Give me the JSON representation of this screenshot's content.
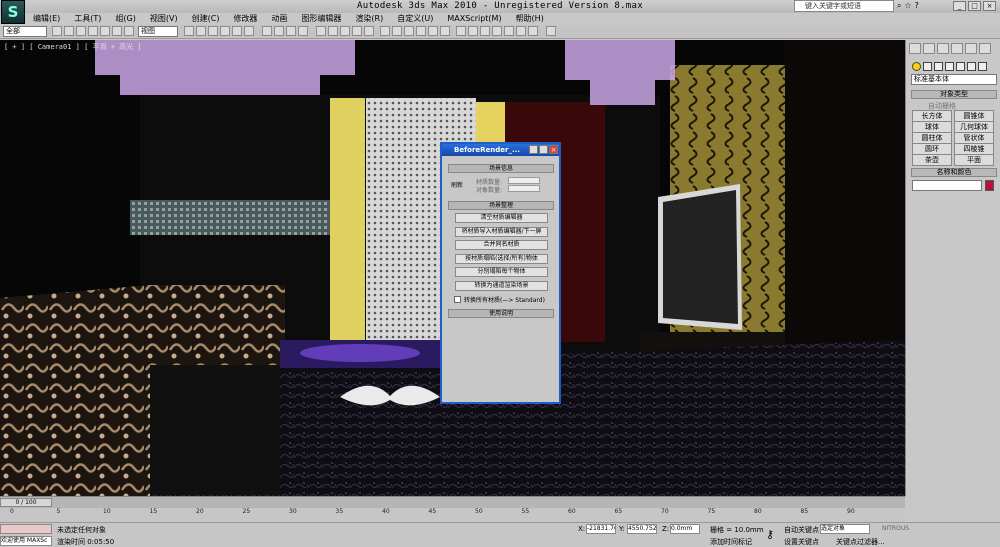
{
  "app": {
    "title": "Autodesk 3ds Max  2010  - Unregistered Version  8.max",
    "logo_text": "S"
  },
  "help_search": {
    "placeholder": "键入关键字或短语"
  },
  "menu": [
    "编辑(E)",
    "工具(T)",
    "组(G)",
    "视图(V)",
    "创建(C)",
    "修改器",
    "动画",
    "图形编辑器",
    "渲染(R)",
    "自定义(U)",
    "MAXScript(M)",
    "帮助(H)"
  ],
  "toolbar": {
    "selection_filter": "全部",
    "ref_coord": "视图"
  },
  "viewport": {
    "label": "[ + ] [ Camera01 ] [ 平滑 + 高光 ]"
  },
  "command_panel": {
    "category": "标准基本体",
    "object_type_header": "对象类型",
    "autogrid": "自动栅格",
    "buttons": [
      "长方体",
      "圆锥体",
      "球体",
      "几何球体",
      "圆柱体",
      "管状体",
      "圆环",
      "四棱锥",
      "茶壶",
      "平面"
    ],
    "name_color_header": "名称和颜色",
    "color": "#b4123a"
  },
  "dialog": {
    "title": "BeforeRender_...",
    "section1": "场景信息",
    "refresh": "刷新",
    "mat_count_label": "材质数量:",
    "obj_count_label": "对象数量:",
    "section2": "场景整理",
    "buttons": [
      "清空材质编辑器",
      "将材质导入材质编辑器/下一屏",
      "合并同名材质",
      "按材质塌陷(选择/所有)物体",
      "分别塌陷每个物体",
      "转换为通道渲染场景"
    ],
    "checkbox_label": "转换所有材质(—> Standard)",
    "section3": "使用说明"
  },
  "timeline": {
    "frame": "0 / 100",
    "ticks": [
      "0",
      "5",
      "10",
      "15",
      "20",
      "25",
      "30",
      "35",
      "40",
      "45",
      "50",
      "55",
      "60",
      "65",
      "70",
      "75",
      "80",
      "85",
      "90"
    ]
  },
  "status": {
    "selected": "未选定任何对象",
    "render_time": "渲染时间 0:05:50",
    "welcome": "欢迎使用 MAXSc",
    "x_label": "X:",
    "x_value": "-21831.76",
    "y_label": "Y:",
    "y_value": "4550.752n",
    "z_label": "Z:",
    "z_value": "0.0mm",
    "grid": "栅格 = 10.0mm",
    "add_time_tag": "添加时间标记",
    "auto_key": "自动关键点",
    "selected_obj": "选定对象",
    "set_key": "设置关键点",
    "key_filter": "关键点过滤器...",
    "nitrous": "NITROUS"
  }
}
